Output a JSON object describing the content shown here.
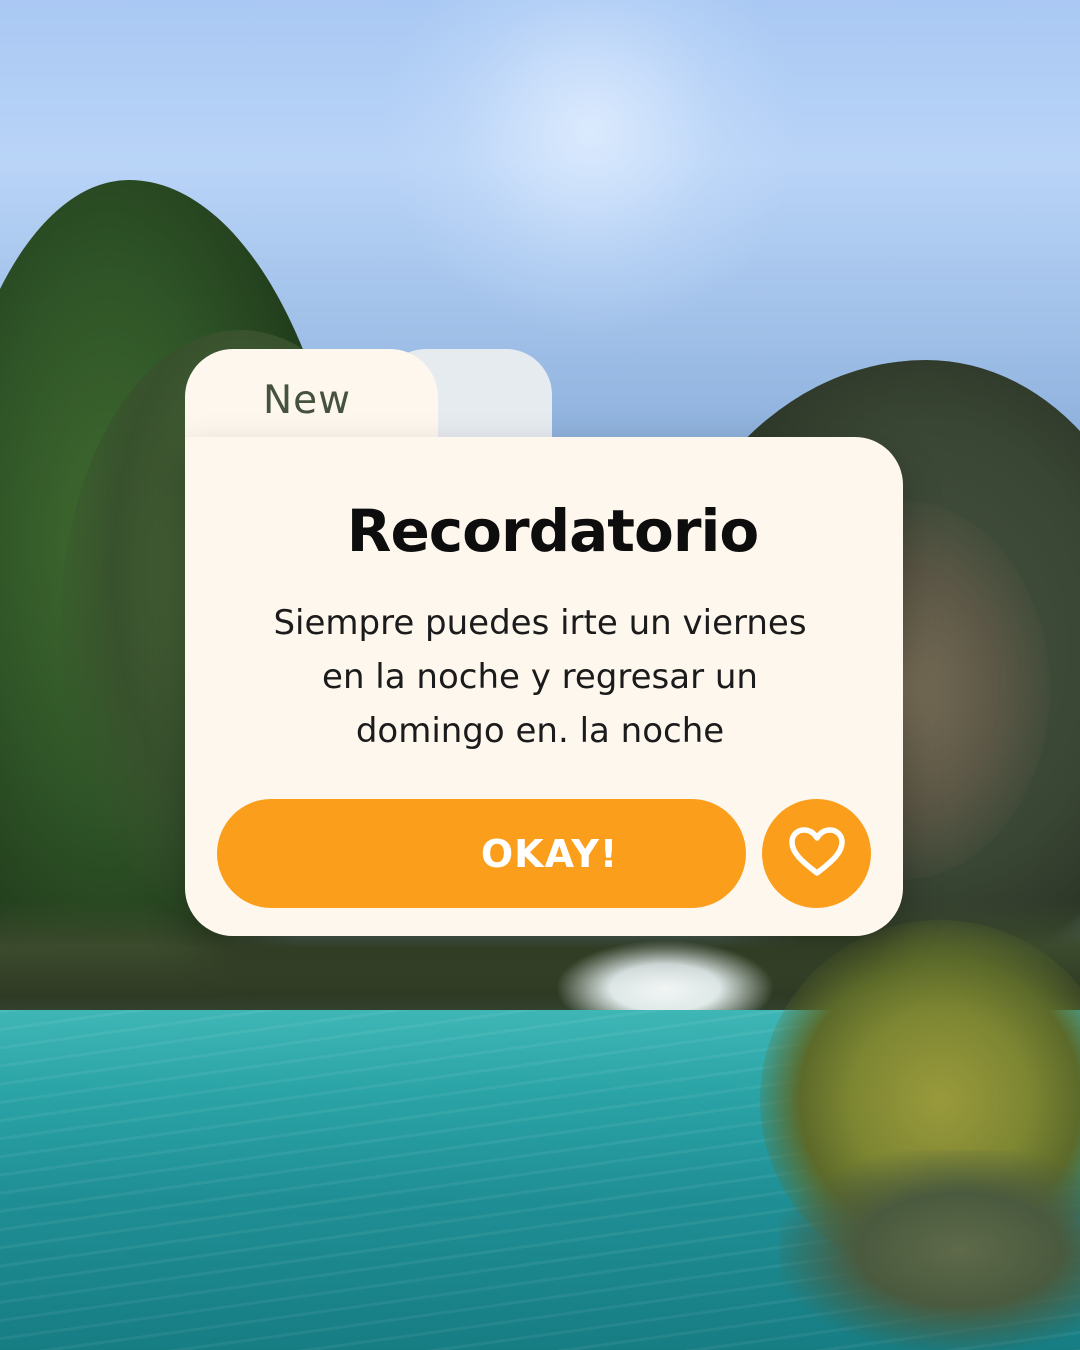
{
  "card": {
    "tab_label": "New",
    "title": "Recordatorio",
    "message_lines": [
      "Siempre puedes irte un viernes",
      "en la noche y regresar un",
      "domingo en. la noche"
    ],
    "primary_button_label": "OKAY!",
    "favorite_icon": "heart-icon"
  },
  "colors": {
    "accent": "#fb9e1c",
    "card_background": "#fdf7ee",
    "back_tab": "#e6ebf0",
    "tab_label_text": "#45533e",
    "title_text": "#0d0d0d"
  },
  "background": {
    "scene": "river-waterfall-photo"
  }
}
